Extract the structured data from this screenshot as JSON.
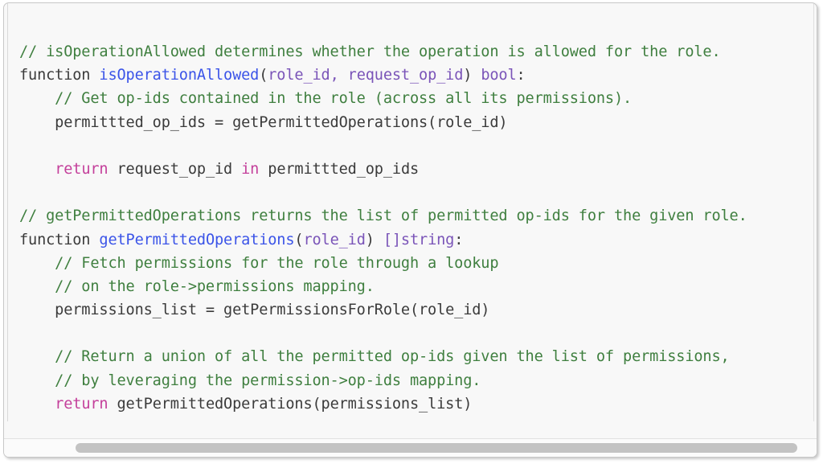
{
  "panel": {
    "name": "code-block-panel",
    "background_color": "#f8f8f8",
    "border_color": "#c8c8c8"
  },
  "theme": {
    "comment_color": "#3f7f3f",
    "keyword_color": "#c4409b",
    "function_name_color": "#3b54e8",
    "type_param_color": "#7a54b8",
    "plain_text_color": "#3b3b3b"
  },
  "code": {
    "language": "pseudocode",
    "lines": [
      {
        "n": 1,
        "tokens": [
          {
            "t": "// isOperationAllowed determines whether the operation is allowed for the role.",
            "c": "cmt"
          }
        ]
      },
      {
        "n": 2,
        "tokens": [
          {
            "t": "function ",
            "c": "pln"
          },
          {
            "t": "isOperationAllowed",
            "c": "fn"
          },
          {
            "t": "(",
            "c": "pln"
          },
          {
            "t": "role_id, request_op_id",
            "c": "typ"
          },
          {
            "t": ") ",
            "c": "pln"
          },
          {
            "t": "bool",
            "c": "typ"
          },
          {
            "t": ":",
            "c": "pln"
          }
        ]
      },
      {
        "n": 3,
        "tokens": [
          {
            "t": "    // Get op-ids contained in the role (across all its permissions).",
            "c": "cmt"
          }
        ]
      },
      {
        "n": 4,
        "tokens": [
          {
            "t": "    permittted_op_ids = getPermittedOperations(role_id)",
            "c": "pln"
          }
        ]
      },
      {
        "n": 5,
        "tokens": [
          {
            "t": "",
            "c": "pln"
          }
        ]
      },
      {
        "n": 6,
        "tokens": [
          {
            "t": "    ",
            "c": "pln"
          },
          {
            "t": "return",
            "c": "kw"
          },
          {
            "t": " request_op_id ",
            "c": "pln"
          },
          {
            "t": "in",
            "c": "kw"
          },
          {
            "t": " permittted_op_ids",
            "c": "pln"
          }
        ]
      },
      {
        "n": 7,
        "tokens": [
          {
            "t": "",
            "c": "pln"
          }
        ]
      },
      {
        "n": 8,
        "tokens": [
          {
            "t": "// getPermittedOperations returns the list of permitted op-ids for the given role.",
            "c": "cmt"
          }
        ]
      },
      {
        "n": 9,
        "tokens": [
          {
            "t": "function ",
            "c": "pln"
          },
          {
            "t": "getPermittedOperations",
            "c": "fn"
          },
          {
            "t": "(",
            "c": "pln"
          },
          {
            "t": "role_id",
            "c": "typ"
          },
          {
            "t": ") ",
            "c": "pln"
          },
          {
            "t": "[]string",
            "c": "typ"
          },
          {
            "t": ":",
            "c": "pln"
          }
        ]
      },
      {
        "n": 10,
        "tokens": [
          {
            "t": "    // Fetch permissions for the role through a lookup",
            "c": "cmt"
          }
        ]
      },
      {
        "n": 11,
        "tokens": [
          {
            "t": "    // on the role->permissions mapping.",
            "c": "cmt"
          }
        ]
      },
      {
        "n": 12,
        "tokens": [
          {
            "t": "    permissions_list = getPermissionsForRole(role_id)",
            "c": "pln"
          }
        ]
      },
      {
        "n": 13,
        "tokens": [
          {
            "t": "",
            "c": "pln"
          }
        ]
      },
      {
        "n": 14,
        "tokens": [
          {
            "t": "    // Return a union of all the permitted op-ids given the list of permissions,",
            "c": "cmt"
          }
        ]
      },
      {
        "n": 15,
        "tokens": [
          {
            "t": "    // by leveraging the permission->op-ids mapping.",
            "c": "cmt"
          }
        ]
      },
      {
        "n": 16,
        "tokens": [
          {
            "t": "    ",
            "c": "pln"
          },
          {
            "t": "return",
            "c": "kw"
          },
          {
            "t": " getPermittedOperations(permissions_list)",
            "c": "pln"
          }
        ]
      }
    ]
  },
  "scrollbar": {
    "orientation": "horizontal",
    "thumb_color": "#c3c3c3",
    "track_color": "#fbfbfb"
  }
}
